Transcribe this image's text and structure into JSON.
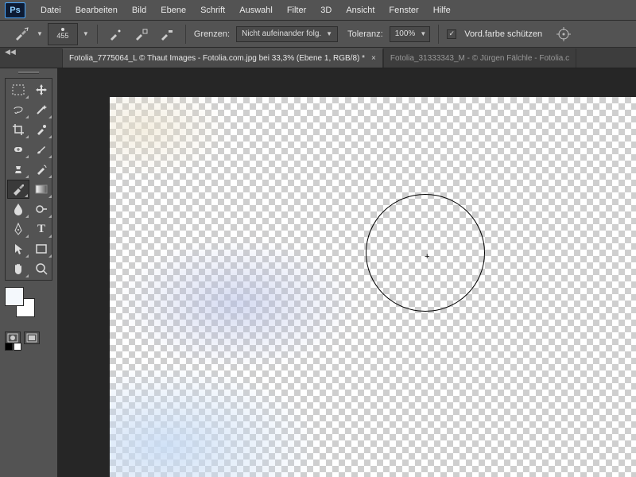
{
  "app": {
    "logo_text": "Ps"
  },
  "menu": [
    "Datei",
    "Bearbeiten",
    "Bild",
    "Ebene",
    "Schrift",
    "Auswahl",
    "Filter",
    "3D",
    "Ansicht",
    "Fenster",
    "Hilfe"
  ],
  "options": {
    "brush_size": "455",
    "grenzen_label": "Grenzen:",
    "grenzen_value": "Nicht aufeinander folg.",
    "toleranz_label": "Toleranz:",
    "toleranz_value": "100%",
    "protect_fg_label": "Vord.farbe schützen"
  },
  "tabs": [
    {
      "title": "Fotolia_7775064_L © Thaut Images - Fotolia.com.jpg bei 33,3% (Ebene 1, RGB/8) *",
      "active": true
    },
    {
      "title": "Fotolia_31333343_M - © Jürgen Fälchle - Fotolia.c",
      "active": false
    }
  ],
  "colors": {
    "fg": "#f4f8fc",
    "bg": "#ffffff"
  }
}
